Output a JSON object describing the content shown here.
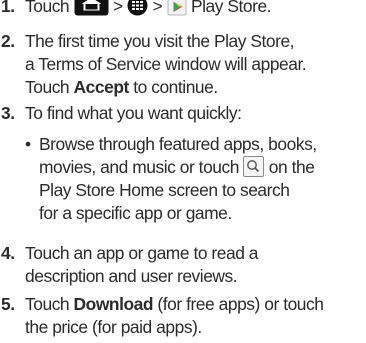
{
  "steps": [
    {
      "number": "1.",
      "prefix": "Touch",
      "sep1": ">",
      "sep2": ">",
      "label": "Play Store.",
      "icons": [
        "home-icon",
        "menu-grid-icon",
        "play-store-icon"
      ]
    },
    {
      "number": "2.",
      "line1": "The first time you visit the Play Store,",
      "line2": "a Terms of Service window will appear.",
      "line3_pre": "Touch ",
      "line3_bold": "Accept",
      "line3_post": " to continue."
    },
    {
      "number": "3.",
      "line1": "To find what you want quickly:",
      "bullet": "•",
      "sub_line1": "Browse through featured apps, books,",
      "sub_line2_pre": "movies, and music or touch",
      "sub_line2_post": "on the",
      "sub_line3": "Play Store Home screen to search",
      "sub_line4": "for a specific app or game.",
      "icon": "search-icon"
    },
    {
      "number": "4.",
      "line1": "Touch an app or game to read a",
      "line2": "description and user reviews."
    },
    {
      "number": "5.",
      "line1_pre": "Touch ",
      "line1_bold": "Download",
      "line1_post": " (for free apps) or touch",
      "line2": "the price (for paid apps)."
    }
  ]
}
